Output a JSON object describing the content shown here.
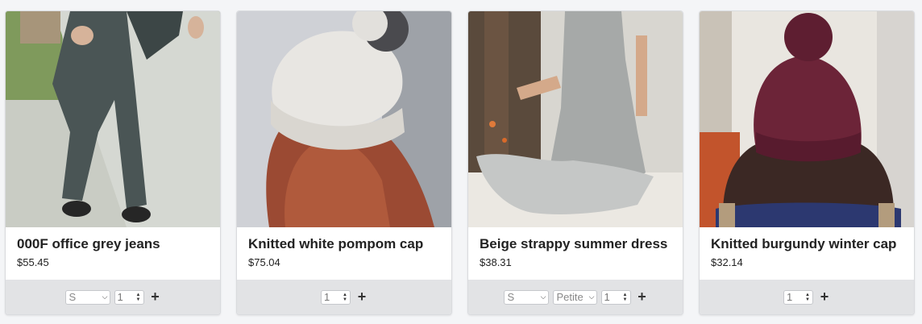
{
  "products": [
    {
      "name": "000F office grey jeans",
      "price": "$55.45",
      "image_icon": "grey-jeans-photo",
      "size_selected": "S",
      "quantity": "1"
    },
    {
      "name": "Knitted white pompom cap",
      "price": "$75.04",
      "image_icon": "white-pompom-cap-photo",
      "quantity": "1"
    },
    {
      "name": "Beige strappy summer dress",
      "price": "$38.31",
      "image_icon": "summer-dress-photo",
      "size_selected": "S",
      "fit_selected": "Petite",
      "quantity": "1"
    },
    {
      "name": "Knitted burgundy winter cap",
      "price": "$32.14",
      "image_icon": "burgundy-cap-photo",
      "quantity": "1"
    }
  ],
  "icons": {
    "add": "+",
    "chevron": "⌄"
  }
}
